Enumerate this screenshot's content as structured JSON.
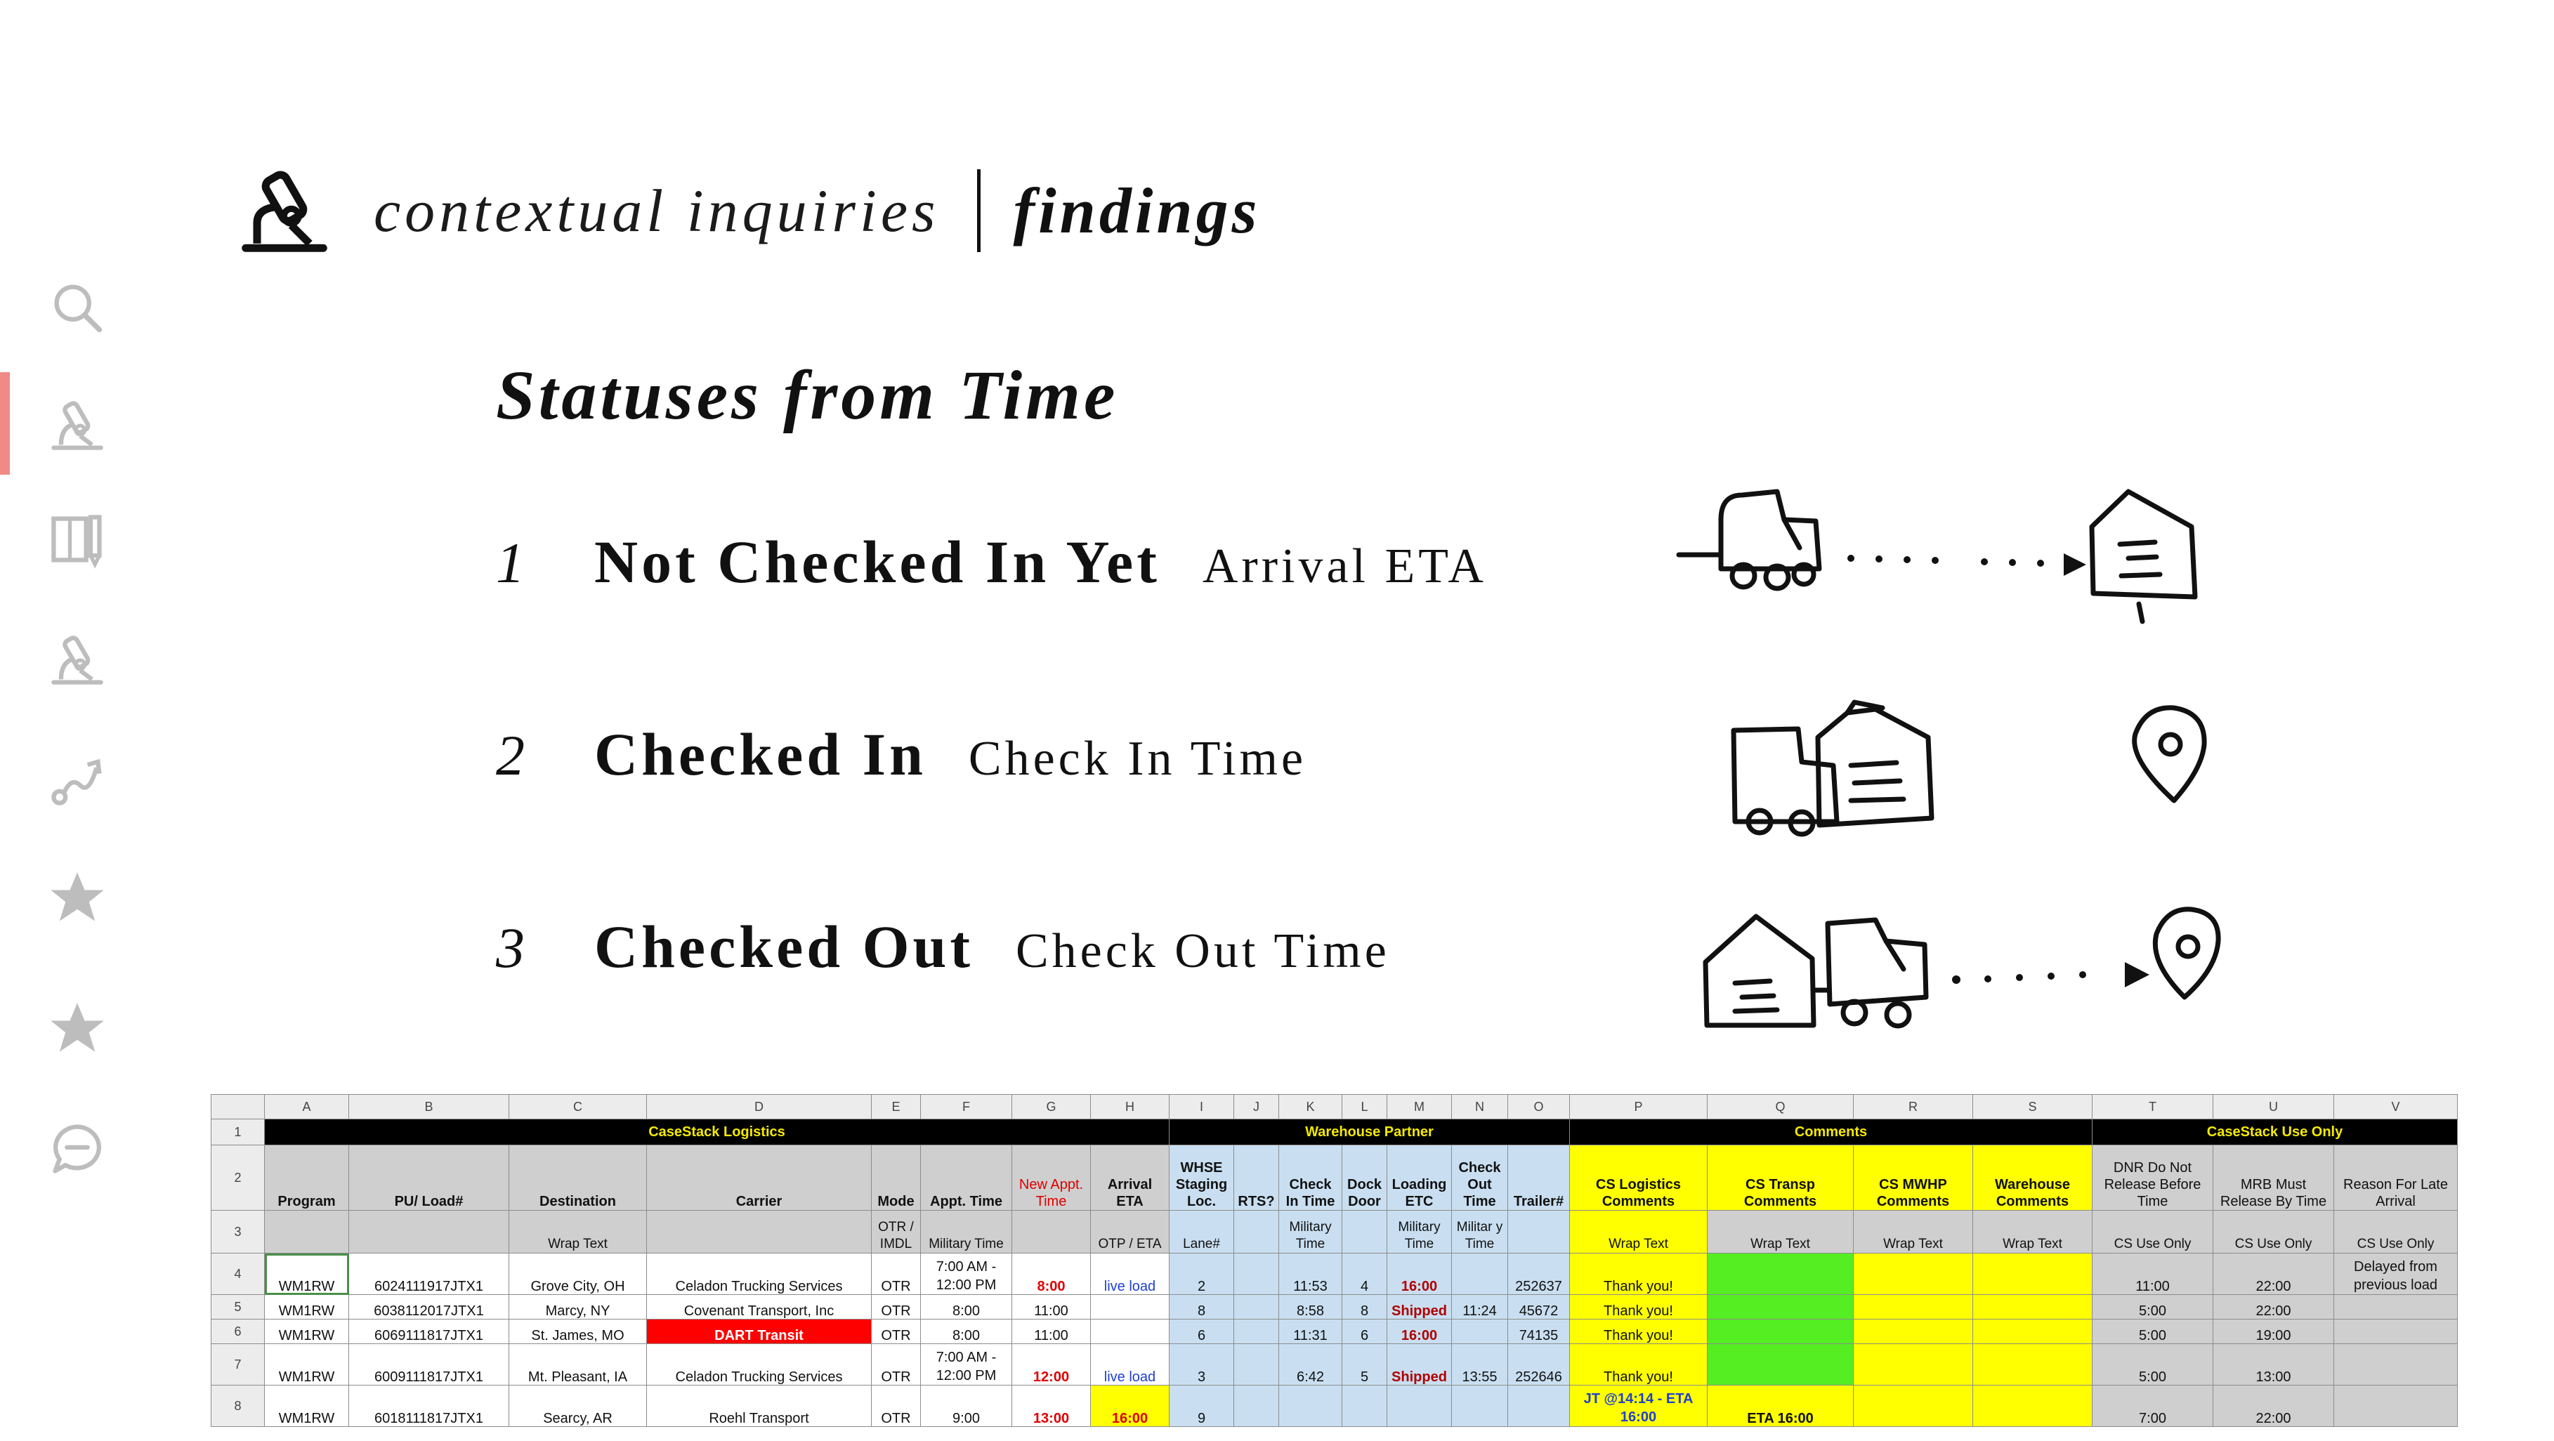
{
  "sidebar": {
    "items": [
      {
        "icon": "search-icon"
      },
      {
        "icon": "microscope-icon",
        "active": true
      },
      {
        "icon": "notebook-pencil-icon"
      },
      {
        "icon": "microscope-icon"
      },
      {
        "icon": "route-path-icon"
      },
      {
        "icon": "star-icon"
      },
      {
        "icon": "star-icon"
      },
      {
        "icon": "chat-bubble-icon"
      }
    ],
    "accent_color": "#f08a87"
  },
  "header": {
    "title": "contextual inquiries",
    "section": "findings",
    "logo_icon": "microscope-icon"
  },
  "section_title": "Statuses from Time",
  "statuses": [
    {
      "num": "1",
      "label": "Not Checked In Yet",
      "desc": "Arrival ETA",
      "sketch": "truck-dotted-arrow-to-warehouse-sketch"
    },
    {
      "num": "2",
      "label": "Checked In",
      "desc": "Check In Time",
      "sketch": "truck-at-warehouse-with-location-pin-sketch"
    },
    {
      "num": "3",
      "label": "Checked Out",
      "desc": "Check Out Time",
      "sketch": "warehouse-truck-dotted-arrow-to-pin-sketch"
    }
  ],
  "spreadsheet": {
    "colors": {
      "group_bg": "#000000",
      "group_text": "#f5ea00",
      "yellow": "#ffff00",
      "green": "#55ee22",
      "light_blue": "#c9dff1",
      "red": "#ff0000"
    },
    "column_letters": [
      "A",
      "B",
      "C",
      "D",
      "E",
      "F",
      "G",
      "H",
      "I",
      "J",
      "K",
      "L",
      "M",
      "N",
      "O",
      "P",
      "Q",
      "R",
      "S",
      "T",
      "U",
      "V"
    ],
    "groups": {
      "logistics": "CaseStack Logistics",
      "warehouse": "Warehouse Partner",
      "comments": "Comments",
      "use_only": "CaseStack Use Only"
    },
    "headers": {
      "program": "Program",
      "load": "PU/ Load#",
      "destination": "Destination",
      "carrier": "Carrier",
      "mode": "Mode",
      "appt": "Appt. Time",
      "new_appt": "New Appt. Time",
      "arrival_eta": "Arrival ETA",
      "staging": "WHSE Staging Loc.",
      "rts": "RTS?",
      "check_in": "Check In Time",
      "dock": "Dock Door",
      "loading": "Loading ETC",
      "check_out": "Check Out Time",
      "trailer": "Trailer#",
      "cs_logistics": "CS Logistics Comments",
      "cs_transp": "CS Transp Comments",
      "cs_mwhp": "CS MWHP Comments",
      "warehouse_comments": "Warehouse Comments",
      "dnr": "DNR Do Not Release Before Time",
      "mrb": "MRB Must Release By Time",
      "late_reason": "Reason For Late Arrival"
    },
    "subheaders": {
      "destination": "Wrap Text",
      "mode": "OTR / IMDL",
      "appt": "Military Time",
      "eta": "OTP / ETA",
      "staging": "Lane#",
      "check_in": "Military Time",
      "loading": "Military Time",
      "check_out": "Militar y Time",
      "p": "Wrap Text",
      "q": "Wrap Text",
      "r": "Wrap Text",
      "s": "Wrap Text",
      "t": "CS Use Only",
      "u": "CS Use Only",
      "v": "CS Use Only"
    },
    "rows": [
      {
        "num": "4",
        "program": "WM1RW",
        "load": "6024111917JTX1",
        "dest": "Grove City, OH",
        "carrier": "Celadon Trucking Services",
        "mode": "OTR",
        "appt": "7:00 AM - 12:00 PM",
        "new_appt": "8:00",
        "eta": "live load",
        "lane": "2",
        "rts": "",
        "check_in": "11:53",
        "dock": "4",
        "loading": "16:00",
        "check_out": "",
        "trailer": "252637",
        "p": "Thank you!",
        "q": "",
        "r": "",
        "s": "",
        "t": "11:00",
        "u": "22:00",
        "v": "Delayed from previous load"
      },
      {
        "num": "5",
        "program": "WM1RW",
        "load": "6038112017JTX1",
        "dest": "Marcy, NY",
        "carrier": "Covenant Transport, Inc",
        "mode": "OTR",
        "appt": "8:00",
        "new_appt": "11:00",
        "eta": "",
        "lane": "8",
        "rts": "",
        "check_in": "8:58",
        "dock": "8",
        "loading": "Shipped",
        "check_out": "11:24",
        "trailer": "45672",
        "p": "Thank you!",
        "q": "",
        "r": "",
        "s": "",
        "t": "5:00",
        "u": "22:00",
        "v": ""
      },
      {
        "num": "6",
        "program": "WM1RW",
        "load": "6069111817JTX1",
        "dest": "St. James, MO",
        "carrier": "DART Transit",
        "mode": "OTR",
        "appt": "8:00",
        "new_appt": "11:00",
        "eta": "",
        "lane": "6",
        "rts": "",
        "check_in": "11:31",
        "dock": "6",
        "loading": "16:00",
        "check_out": "",
        "trailer": "74135",
        "p": "Thank you!",
        "q": "",
        "r": "",
        "s": "",
        "t": "5:00",
        "u": "19:00",
        "v": ""
      },
      {
        "num": "7",
        "program": "WM1RW",
        "load": "6009111817JTX1",
        "dest": "Mt. Pleasant, IA",
        "carrier": "Celadon Trucking Services",
        "mode": "OTR",
        "appt": "7:00 AM - 12:00 PM",
        "new_appt": "12:00",
        "eta": "live load",
        "lane": "3",
        "rts": "",
        "check_in": "6:42",
        "dock": "5",
        "loading": "Shipped",
        "check_out": "13:55",
        "trailer": "252646",
        "p": "Thank you!",
        "q": "",
        "r": "",
        "s": "",
        "t": "5:00",
        "u": "13:00",
        "v": ""
      },
      {
        "num": "8",
        "program": "WM1RW",
        "load": "6018111817JTX1",
        "dest": "Searcy, AR",
        "carrier": "Roehl Transport",
        "mode": "OTR",
        "appt": "9:00",
        "new_appt": "13:00",
        "eta": "16:00",
        "lane": "9",
        "rts": "",
        "check_in": "",
        "dock": "",
        "loading": "",
        "check_out": "",
        "trailer": "",
        "p": "JT @14:14 - ETA 16:00",
        "q": "ETA 16:00",
        "r": "",
        "s": "",
        "t": "7:00",
        "u": "22:00",
        "v": ""
      }
    ]
  }
}
